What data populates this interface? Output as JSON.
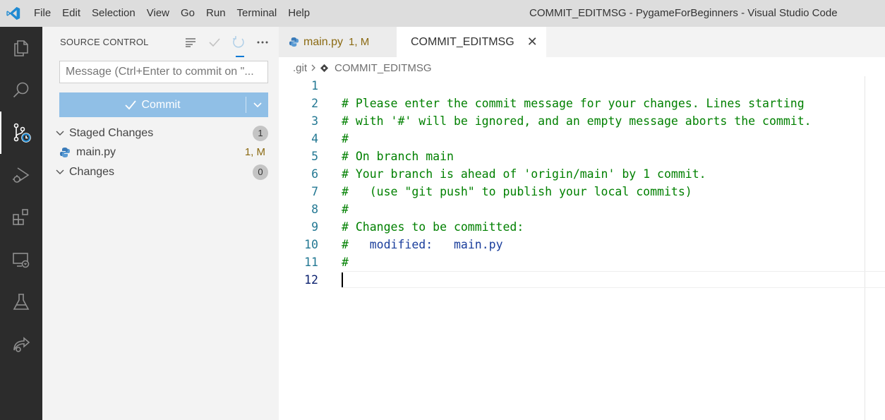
{
  "titlebar": {
    "menu": [
      "File",
      "Edit",
      "Selection",
      "View",
      "Go",
      "Run",
      "Terminal",
      "Help"
    ],
    "title": "COMMIT_EDITMSG - PygameForBeginners - Visual Studio Code"
  },
  "activity_bar": {
    "items": [
      "explorer-icon",
      "search-icon",
      "source-control-icon",
      "run-debug-icon",
      "extensions-icon",
      "remote-explorer-icon",
      "testing-icon",
      "live-share-icon"
    ],
    "active": "source-control-icon"
  },
  "sidebar": {
    "header": "SOURCE CONTROL",
    "message_placeholder": "Message (Ctrl+Enter to commit on \"...",
    "commit_label": "Commit",
    "staged": {
      "label": "Staged Changes",
      "count": "1"
    },
    "staged_file": {
      "name": "main.py",
      "status": "1, M"
    },
    "changes": {
      "label": "Changes",
      "count": "0"
    }
  },
  "tabs": [
    {
      "label": "main.py",
      "status": "1, M"
    },
    {
      "label": "COMMIT_EDITMSG",
      "close": "✕"
    }
  ],
  "breadcrumbs": {
    "folder": ".git",
    "file": "COMMIT_EDITMSG"
  },
  "editor": {
    "lines": [
      {
        "n": "1",
        "text": ""
      },
      {
        "n": "2",
        "text": "# Please enter the commit message for your changes. Lines starting"
      },
      {
        "n": "3",
        "text": "# with '#' will be ignored, and an empty message aborts the commit."
      },
      {
        "n": "4",
        "text": "#"
      },
      {
        "n": "5",
        "text": "# On branch main"
      },
      {
        "n": "6",
        "text": "# Your branch is ahead of 'origin/main' by 1 commit."
      },
      {
        "n": "7",
        "text": "#   (use \"git push\" to publish your local commits)"
      },
      {
        "n": "8",
        "text": "#"
      },
      {
        "n": "9",
        "text": "# Changes to be committed:"
      },
      {
        "n": "10",
        "text": "#   modified:   main.py"
      },
      {
        "n": "11",
        "text": "#"
      },
      {
        "n": "12",
        "text": ""
      }
    ],
    "current_line": "12"
  },
  "colors": {
    "accent": "#0078d4",
    "commit_button": "#90bfe6",
    "comment": "#008000",
    "keyword": "#1a3e9c",
    "line_number": "#237893",
    "modified": "#8b6a12"
  }
}
